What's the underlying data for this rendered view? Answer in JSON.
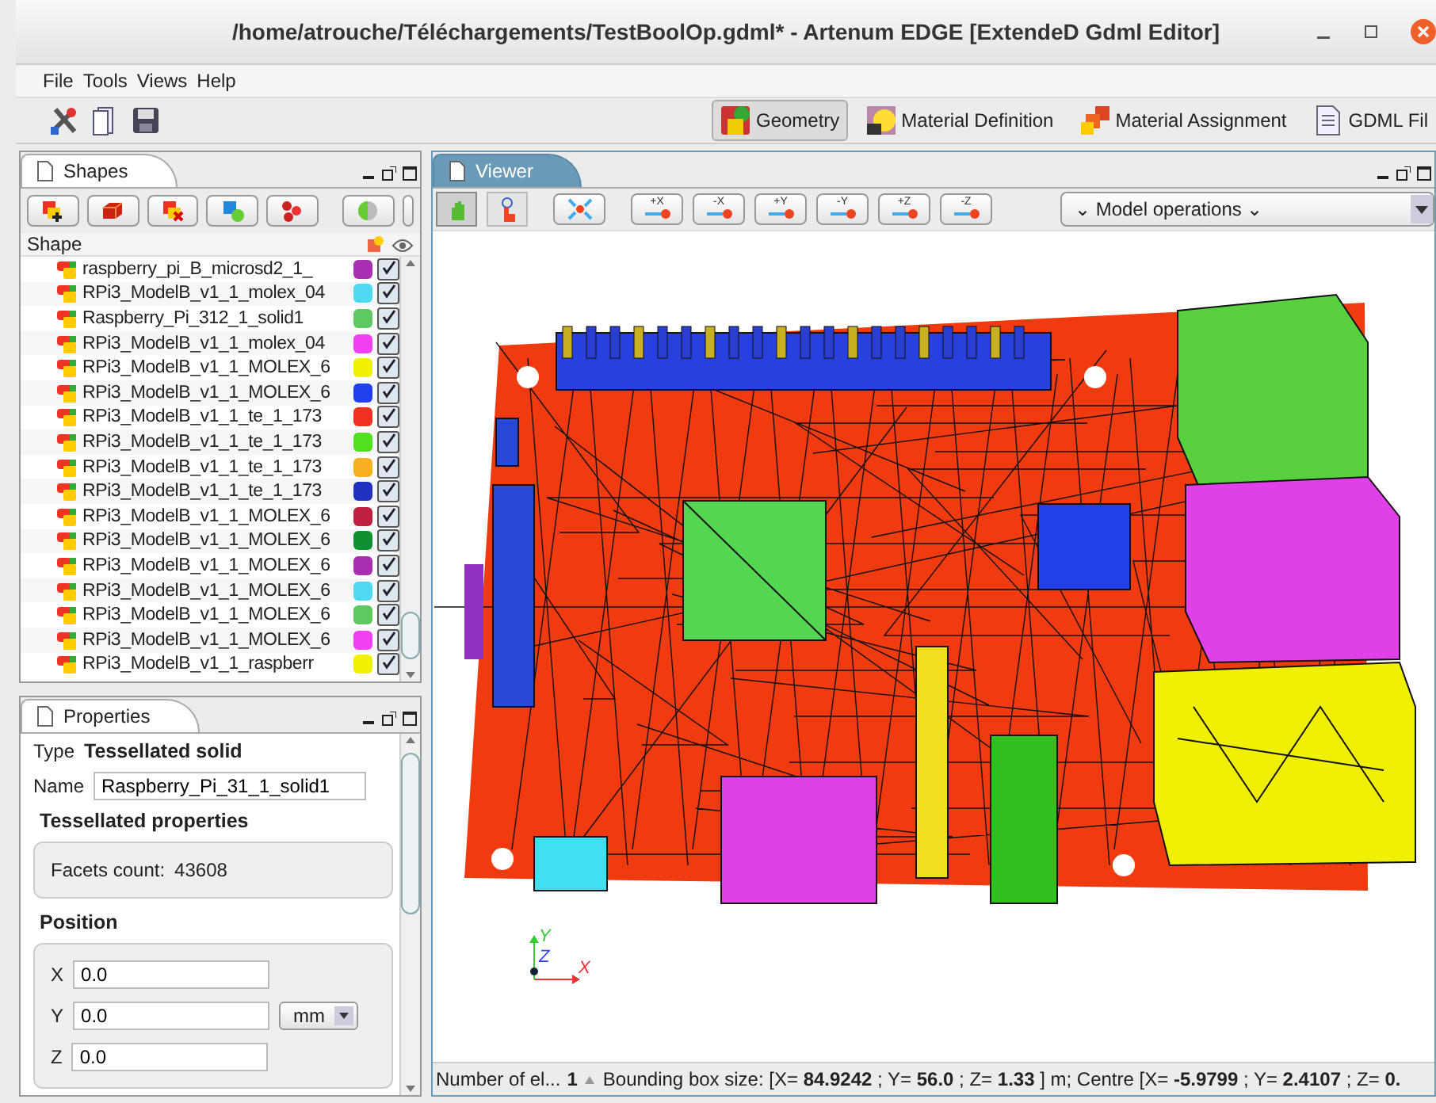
{
  "window": {
    "title": "/home/atrouche/Téléchargements/TestBoolOp.gdml* - Artenum EDGE [ExtendeD Gdml Editor]"
  },
  "menu": [
    "File",
    "Tools",
    "Views",
    "Help"
  ],
  "perspectives": [
    {
      "label": "Geometry",
      "selected": true
    },
    {
      "label": "Material Definition",
      "selected": false
    },
    {
      "label": "Material Assignment",
      "selected": false
    },
    {
      "label": "GDML Fil",
      "selected": false
    }
  ],
  "shapes_panel": {
    "title": "Shapes",
    "column": "Shape",
    "rows": [
      {
        "name": "raspberry_pi_B_microsd2_1_",
        "color": "#a830b0",
        "visible": true
      },
      {
        "name": "RPi3_ModelB_v1_1_molex_04",
        "color": "#50d8f0",
        "visible": true
      },
      {
        "name": "Raspberry_Pi_312_1_solid1",
        "color": "#60c860",
        "visible": true
      },
      {
        "name": "RPi3_ModelB_v1_1_molex_04",
        "color": "#f040f0",
        "visible": true
      },
      {
        "name": "RPi3_ModelB_v1_1_MOLEX_6",
        "color": "#f0f000",
        "visible": true
      },
      {
        "name": "RPi3_ModelB_v1_1_MOLEX_6",
        "color": "#2040f0",
        "visible": true
      },
      {
        "name": "RPi3_ModelB_v1_1_te_1_173",
        "color": "#f03020",
        "visible": true
      },
      {
        "name": "RPi3_ModelB_v1_1_te_1_173",
        "color": "#50e020",
        "visible": true
      },
      {
        "name": "RPi3_ModelB_v1_1_te_1_173",
        "color": "#f8b020",
        "visible": true
      },
      {
        "name": "RPi3_ModelB_v1_1_te_1_173",
        "color": "#2030c0",
        "visible": true
      },
      {
        "name": "RPi3_ModelB_v1_1_MOLEX_6",
        "color": "#c02040",
        "visible": true
      },
      {
        "name": "RPi3_ModelB_v1_1_MOLEX_6",
        "color": "#109030",
        "visible": true
      },
      {
        "name": "RPi3_ModelB_v1_1_MOLEX_6",
        "color": "#a830b0",
        "visible": true
      },
      {
        "name": "RPi3_ModelB_v1_1_MOLEX_6",
        "color": "#50d8f0",
        "visible": true
      },
      {
        "name": "RPi3_ModelB_v1_1_MOLEX_6",
        "color": "#60c860",
        "visible": true
      },
      {
        "name": "RPi3_ModelB_v1_1_MOLEX_6",
        "color": "#f040f0",
        "visible": true
      },
      {
        "name": "RPi3_ModelB_v1_1_raspberr",
        "color": "#f0f000",
        "visible": true
      }
    ]
  },
  "properties_panel": {
    "title": "Properties",
    "type_label": "Type",
    "type_value": "Tessellated solid",
    "name_label": "Name",
    "name_value": "Raspberry_Pi_31_1_solid1",
    "tessellated_heading": "Tessellated properties",
    "facets_label": "Facets count:",
    "facets_value": "43608",
    "position_heading": "Position",
    "coords": [
      {
        "label": "X",
        "value": "0.0"
      },
      {
        "label": "Y",
        "value": "0.0"
      },
      {
        "label": "Z",
        "value": "0.0"
      }
    ],
    "unit": "mm"
  },
  "viewer": {
    "title": "Viewer",
    "modes": [
      {
        "kind": "hand",
        "selected": true
      },
      {
        "kind": "pick",
        "selected": false
      }
    ],
    "view_buttons": [
      "+X",
      "-X",
      "+Y",
      "-Y",
      "+Z",
      "-Z"
    ],
    "operations": "⌄ Model operations ⌄",
    "axes": [
      "X",
      "Y",
      "Z"
    ]
  },
  "status_bar": {
    "label": "Number of el...",
    "count": "1",
    "text": "Bounding box size: [X= **84.9242** ; Y= **56.0** ; Z= **1.33** ] m;  Centre [X= **-5.9799** ; Y= **2.4107** ; Z= **0.**"
  }
}
